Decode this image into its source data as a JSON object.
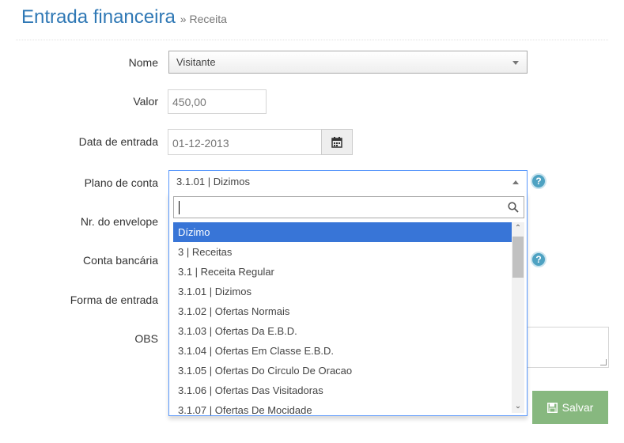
{
  "header": {
    "title": "Entrada financeira",
    "breadcrumb": "» Receita"
  },
  "form": {
    "nome": {
      "label": "Nome",
      "value": "Visitante"
    },
    "valor": {
      "label": "Valor",
      "value": "450,00"
    },
    "data_entrada": {
      "label": "Data de entrada",
      "value": "01-12-2013"
    },
    "plano_conta": {
      "label": "Plano de conta",
      "value": "3.1.01 | Dizimos"
    },
    "nr_envelope": {
      "label": "Nr. do envelope"
    },
    "conta_bancaria": {
      "label": "Conta bancária"
    },
    "forma_entrada": {
      "label": "Forma de entrada"
    },
    "obs": {
      "label": "OBS"
    },
    "help": "?"
  },
  "dropdown": {
    "options": [
      "Dízimo",
      "3 | Receitas",
      "3.1 | Receita Regular",
      "3.1.01 | Dizimos",
      "3.1.02 | Ofertas Normais",
      "3.1.03 | Ofertas Da E.B.D.",
      "3.1.04 | Ofertas Em Classe E.B.D.",
      "3.1.05 | Ofertas Do Circulo De Oracao",
      "3.1.06 | Ofertas Das Visitadoras",
      "3.1.07 | Ofertas De Mocidade"
    ],
    "selected_index": 0
  },
  "buttons": {
    "save": "Salvar"
  },
  "colors": {
    "title": "#2f78b5",
    "highlight": "#3875d7",
    "save": "#87b87f",
    "help": "#4ea2c2"
  },
  "icons": {
    "calendar": "calendar-icon",
    "search": "search-icon",
    "save": "floppy-disk-icon",
    "help": "help-icon"
  }
}
